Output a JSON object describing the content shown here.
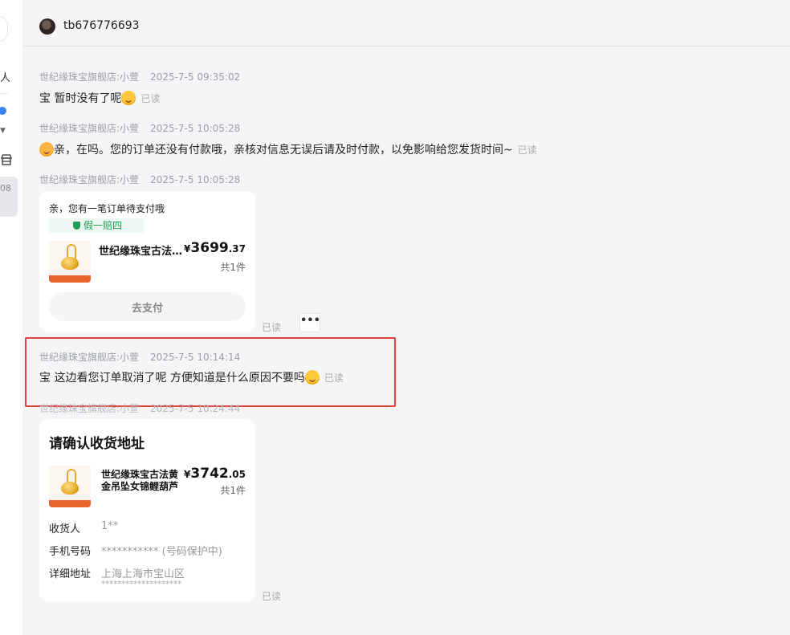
{
  "sidebar": {
    "partial_label": "人",
    "badge_partial": "08"
  },
  "header": {
    "username": "tb676776693"
  },
  "messages": [
    {
      "sender": "世纪缘珠宝旗舰店:小萱",
      "time": "2025-7-5 09:35:02",
      "text": "宝 暂时没有了呢",
      "read": "已读"
    },
    {
      "sender": "世纪缘珠宝旗舰店:小萱",
      "time": "2025-7-5 10:05:28",
      "text": "亲，在吗。您的订单还没有付款哦，亲核对信息无误后请及时付款，以免影响给您发货时间~",
      "read": "已读"
    },
    {
      "sender": "世纪缘珠宝旗舰店:小萱",
      "time": "2025-7-5 10:05:28",
      "read": "已读"
    },
    {
      "sender": "世纪缘珠宝旗舰店:小萱",
      "time": "2025-7-5 10:14:14",
      "text": "宝 这边看您订单取消了呢 方便知道是什么原因不要吗",
      "read": "已读"
    },
    {
      "sender": "世纪缘珠宝旗舰店:小萱",
      "time": "2025-7-5 10:24:44",
      "read": "已读"
    }
  ],
  "order_card": {
    "title": "亲，您有一笔订单待支付哦",
    "badge": "假一赔四",
    "product_name": "世纪缘珠宝古法黄金吊坠女锦鲤葫芦",
    "price_symbol": "¥",
    "price_int": "3699",
    "price_dec": ".37",
    "quantity": "共1件",
    "button": "去支付"
  },
  "address_card": {
    "title": "请确认收货地址",
    "product_name_line1": "世纪缘珠宝古法黄",
    "product_name_line2": "金吊坠女锦鲤葫芦",
    "price_symbol": "¥",
    "price_int": "3742",
    "price_dec": ".05",
    "quantity": "共1件",
    "recipient_label": "收货人",
    "recipient_value": "1**",
    "phone_label": "手机号码",
    "phone_value": "*********** (号码保护中)",
    "address_label": "详细地址",
    "address_value": "上海上海市宝山区",
    "address_mask": "********************"
  },
  "colors": {
    "highlight": "#e0413a",
    "badge_green": "#1f9d55",
    "unread_dot": "#3b82f6"
  }
}
